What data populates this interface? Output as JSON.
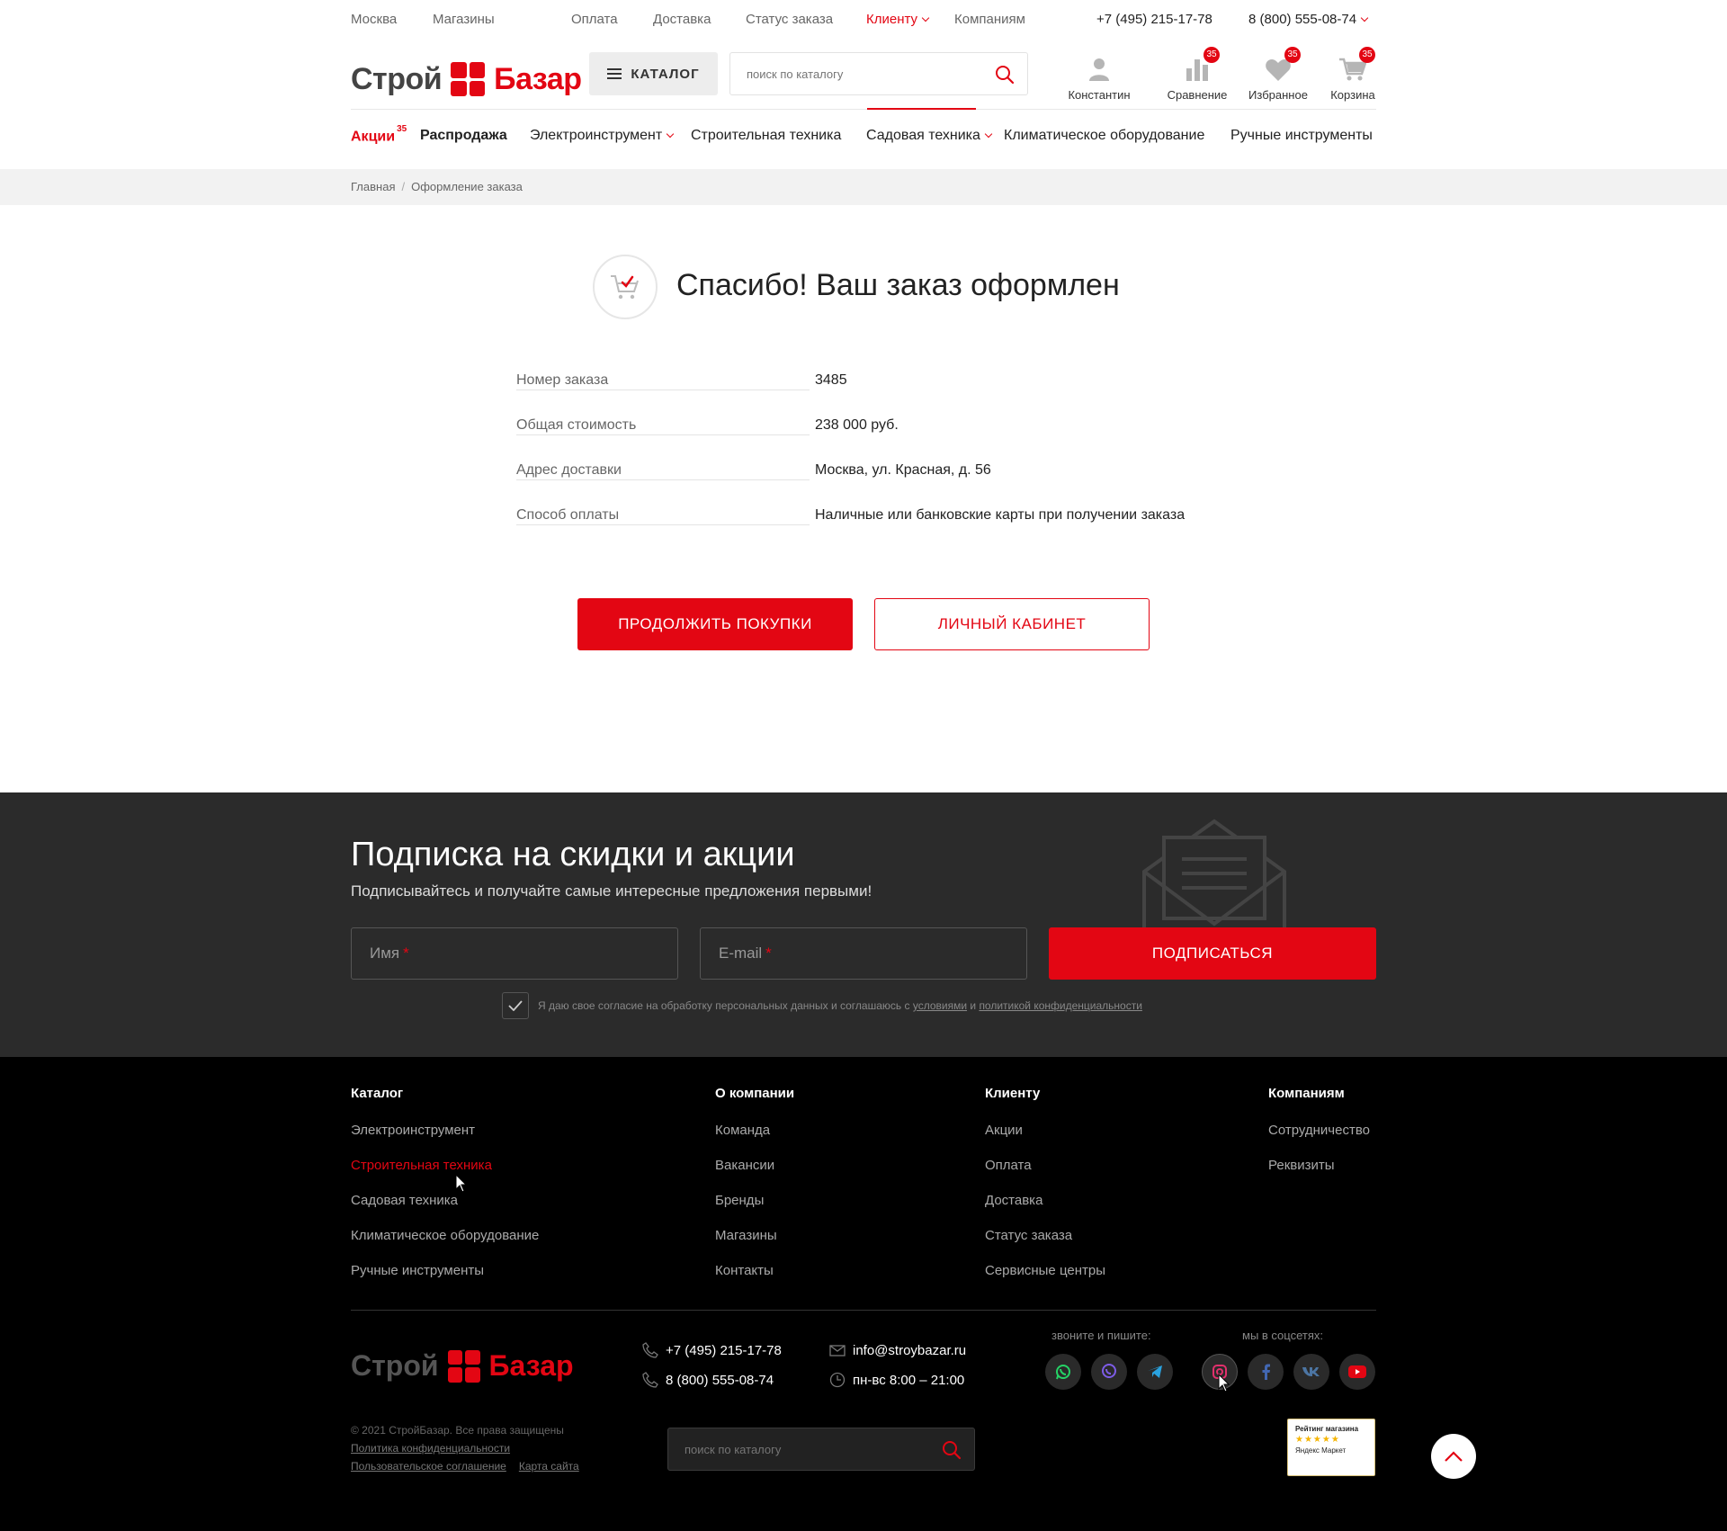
{
  "topbar": {
    "city": "Москва",
    "stores": "Магазины",
    "payment": "Оплата",
    "delivery": "Доставка",
    "order_status": "Статус заказа",
    "client": "Клиенту",
    "companies": "Компаниям",
    "phone1": "+7 (495) 215-17-78",
    "phone2": "8 (800) 555-08-74"
  },
  "header": {
    "logo_word1": "Строй",
    "logo_word2": "Базар",
    "catalog_label": "КАТАЛОГ",
    "search_placeholder": "поиск по каталогу",
    "user_label": "Константин",
    "compare_label": "Сравнение",
    "compare_count": "35",
    "favorites_label": "Избранное",
    "favorites_count": "35",
    "cart_label": "Корзина",
    "cart_count": "35"
  },
  "nav": {
    "items": [
      {
        "label": "Акции",
        "badge": "35"
      },
      {
        "label": "Распродажа"
      },
      {
        "label": "Электроинструмент"
      },
      {
        "label": "Строительная техника"
      },
      {
        "label": "Садовая техника"
      },
      {
        "label": "Климатическое оборудование"
      },
      {
        "label": "Ручные инструменты"
      }
    ]
  },
  "breadcrumb": [
    "Главная",
    "Оформление заказа"
  ],
  "order": {
    "title": "Спасибо! Ваш заказ оформлен",
    "rows": [
      {
        "key": "Номер заказа",
        "value": "3485"
      },
      {
        "key": "Общая стоимость",
        "value": "238 000 руб."
      },
      {
        "key": "Адрес доставки",
        "value": "Москва, ул. Красная, д. 56"
      },
      {
        "key": "Способ оплаты",
        "value": "Наличные или банковские карты при получении заказа"
      }
    ],
    "continue_label": "ПРОДОЛЖИТЬ ПОКУПКИ",
    "account_label": "ЛИЧНЫЙ КАБИНЕТ"
  },
  "subscribe": {
    "title": "Подписка на скидки и акции",
    "text": "Подписывайтесь и получайте самые интересные предложения первыми!",
    "name_placeholder": "Имя",
    "email_placeholder": "E-mail",
    "required_mark": "*",
    "button_label": "ПОДПИСАТЬСЯ",
    "consent_text": "Я даю свое согласие на обработку персональных данных и соглашаюсь с",
    "consent_link1": "условиями",
    "consent_and": "и",
    "consent_link2": "политикой конфиденциальности"
  },
  "footer": {
    "catalog_title": "Каталог",
    "catalog_links": [
      "Электроинструмент",
      "Строительная техника",
      "Садовая техника",
      "Климатическое оборудование",
      "Ручные инструменты"
    ],
    "company_title": "О компании",
    "company_links": [
      "Команда",
      "Вакансии",
      "Бренды",
      "Магазины",
      "Контакты"
    ],
    "client_title": "Клиенту",
    "client_links": [
      "Акции",
      "Оплата",
      "Доставка",
      "Статус заказа",
      "Сервисные центры"
    ],
    "companies_title": "Компаниям",
    "companies_links": [
      "Сотрудничество",
      "Реквизиты"
    ],
    "logo_word1": "Строй",
    "logo_word2": "Базар",
    "phone1": "+7 (495) 215-17-78",
    "phone2": "8 (800) 555-08-74",
    "email": "info@stroybazar.ru",
    "hours": "пн-вс 8:00 – 21:00",
    "call_caption": "звоните и пишите:",
    "social_caption": "мы в соцсетях:",
    "copyright": "© 2021 СтройБазар. Все права защищены",
    "privacy": "Политика конфиденциальности",
    "agreement": "Пользовательское соглашение",
    "sitemap": "Карта сайта",
    "search_placeholder": "поиск по каталогу",
    "rating_title": "Рейтинг магазина",
    "rating_stars": "★★★★★",
    "rating_source": "Яндекс Маркет"
  },
  "colors": {
    "accent": "#e30613",
    "subscribe_bg": "#2b2b2b",
    "footer_bg": "#000000"
  }
}
